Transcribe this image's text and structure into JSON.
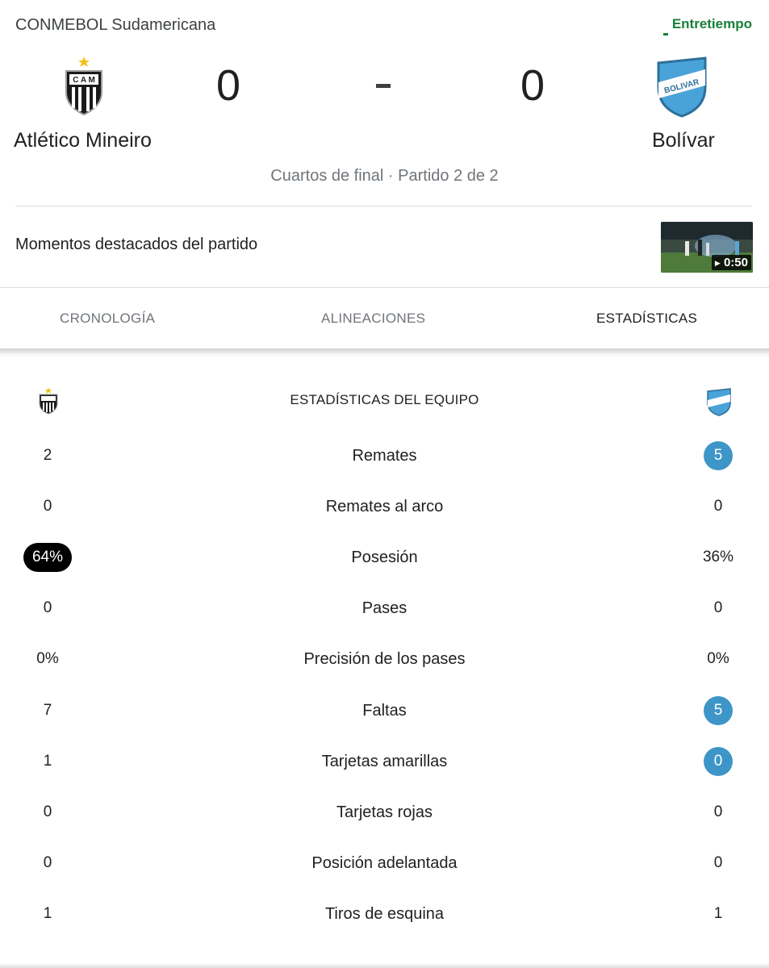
{
  "header": {
    "competition": "CONMEBOL Sudamericana",
    "status": "Entretiempo"
  },
  "match": {
    "home_team": "Atlético Mineiro",
    "away_team": "Bolívar",
    "home_score": "0",
    "away_score": "0",
    "round": "Cuartos de final · Partido 2 de 2",
    "home_crest_text": "C A M",
    "away_crest_text": "BOLIVAR"
  },
  "highlights": {
    "label": "Momentos destacados del partido",
    "duration": "0:50"
  },
  "tabs": [
    {
      "label": "CRONOLOGÍA",
      "active": false
    },
    {
      "label": "ALINEACIONES",
      "active": false
    },
    {
      "label": "ESTADÍSTICAS",
      "active": true
    }
  ],
  "stats": {
    "title": "ESTADÍSTICAS DEL EQUIPO",
    "rows": [
      {
        "label": "Remates",
        "home": "2",
        "away": "5",
        "highlight": "away"
      },
      {
        "label": "Remates al arco",
        "home": "0",
        "away": "0",
        "highlight": "none"
      },
      {
        "label": "Posesión",
        "home": "64%",
        "away": "36%",
        "highlight": "home"
      },
      {
        "label": "Pases",
        "home": "0",
        "away": "0",
        "highlight": "none"
      },
      {
        "label": "Precisión de los pases",
        "home": "0%",
        "away": "0%",
        "highlight": "none"
      },
      {
        "label": "Faltas",
        "home": "7",
        "away": "5",
        "highlight": "away"
      },
      {
        "label": "Tarjetas amarillas",
        "home": "1",
        "away": "0",
        "highlight": "away"
      },
      {
        "label": "Tarjetas rojas",
        "home": "0",
        "away": "0",
        "highlight": "none"
      },
      {
        "label": "Posición adelantada",
        "home": "0",
        "away": "0",
        "highlight": "none"
      },
      {
        "label": "Tiros de esquina",
        "home": "1",
        "away": "1",
        "highlight": "none"
      }
    ]
  },
  "colors": {
    "status_green": "#188038",
    "highlight_home": "#000000",
    "highlight_away": "#3d95c8",
    "muted": "#70757a"
  }
}
